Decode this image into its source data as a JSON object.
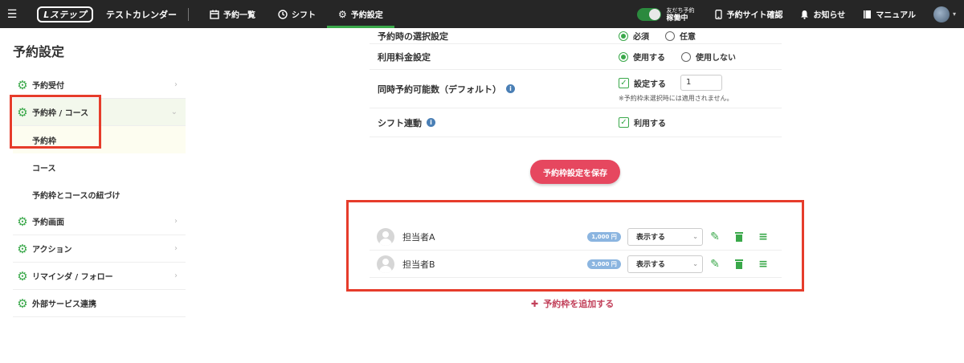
{
  "topbar": {
    "menu_icon": "☰",
    "logo": "Lステップ",
    "calendar_name": "テストカレンダー",
    "nav": [
      {
        "icon": "calendar-icon",
        "label": "予約一覧"
      },
      {
        "icon": "clock-icon",
        "label": "シフト"
      },
      {
        "icon": "gear-icon",
        "label": "予約設定",
        "active": true
      }
    ],
    "toggle_small": "友だち予約",
    "toggle_status": "稼働中",
    "tools": [
      {
        "icon": "phone-icon",
        "label": "予約サイト確認"
      },
      {
        "icon": "bell-icon",
        "label": "お知らせ"
      },
      {
        "icon": "book-icon",
        "label": "マニュアル"
      }
    ]
  },
  "sidebar": {
    "title": "予約設定",
    "items": [
      {
        "label": "予約受付"
      },
      {
        "label": "予約枠 / コース",
        "open": true
      },
      {
        "label": "予約枠",
        "sub": true,
        "active": true
      },
      {
        "label": "コース",
        "sub": true
      },
      {
        "label": "予約枠とコースの紐づけ",
        "sub": true
      },
      {
        "label": "予約画面"
      },
      {
        "label": "アクション"
      },
      {
        "label": "リマインダ / フォロー"
      },
      {
        "label": "外部サービス連携"
      }
    ]
  },
  "settings": {
    "select_setting": {
      "label": "予約時の選択設定",
      "options": [
        "必須",
        "任意"
      ],
      "selected": "必須"
    },
    "fee_setting": {
      "label": "利用料金設定",
      "options": [
        "使用する",
        "使用しない"
      ],
      "selected": "使用する"
    },
    "concurrent": {
      "label": "同時予約可能数（デフォルト）",
      "checkbox_label": "設定する",
      "value": "1",
      "note": "※予約枠未選択時には適用されません。"
    },
    "shift_link": {
      "label": "シフト連動",
      "checkbox_label": "利用する"
    },
    "save_label": "予約枠設定を保存"
  },
  "staff": [
    {
      "name": "担当者A",
      "price": "1,000 円",
      "display": "表示する"
    },
    {
      "name": "担当者B",
      "price": "3,000 円",
      "display": "表示する"
    }
  ],
  "add_label": "予約枠を追加する",
  "colors": {
    "accent": "#3aa84a",
    "save": "#e6475f",
    "highlight": "#e63c2b",
    "topbar": "#262626"
  }
}
